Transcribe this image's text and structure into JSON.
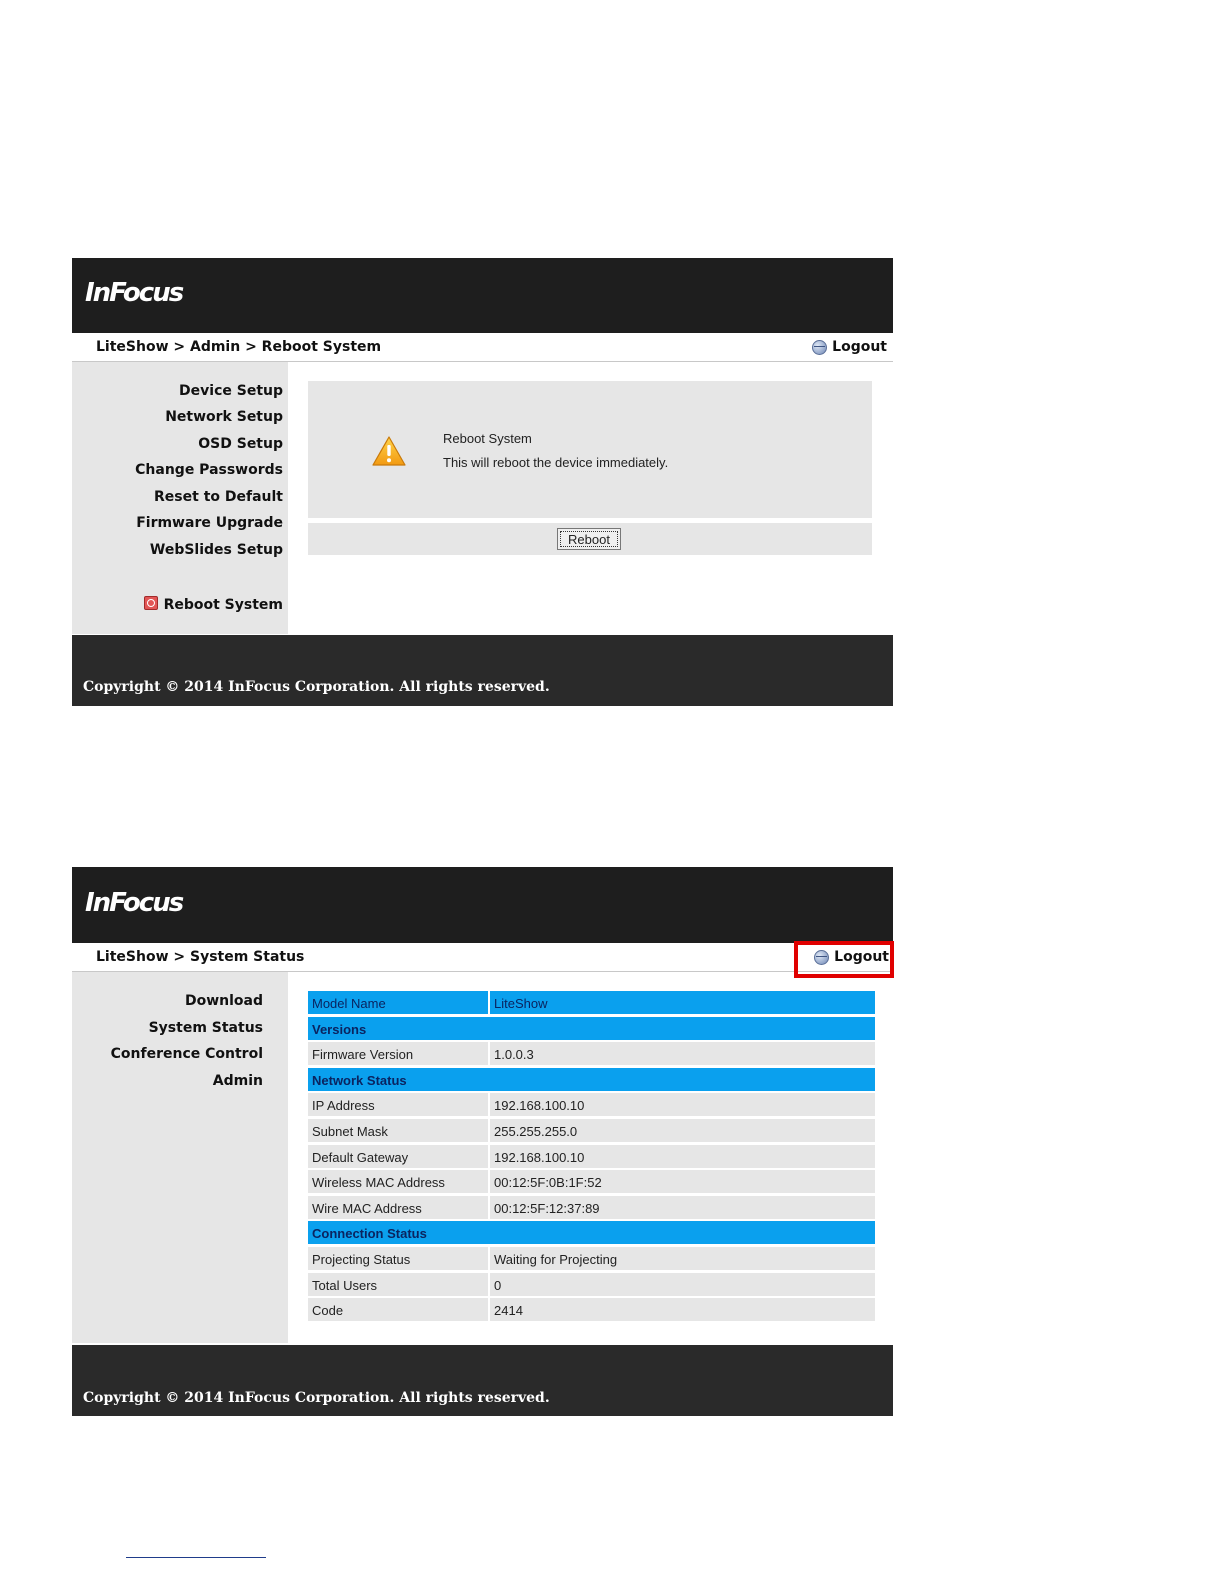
{
  "screen1": {
    "logo": "InFocus",
    "breadcrumb": "LiteShow > Admin > Reboot System",
    "logout_label": "Logout",
    "nav": [
      "Device Setup",
      "Network Setup",
      "OSD Setup",
      "Change Passwords",
      "Reset to Default",
      "Firmware Upgrade",
      "WebSlides Setup"
    ],
    "nav_active": "Reboot System",
    "reboot_title": "Reboot System",
    "reboot_desc": "This will reboot the device immediately.",
    "reboot_button": "Reboot",
    "copyright": "Copyright © 2014 InFocus Corporation. All rights reserved."
  },
  "screen2": {
    "logo": "InFocus",
    "breadcrumb": "LiteShow > System Status",
    "logout_label": "Logout",
    "nav": [
      "Download",
      "System Status",
      "Conference Control",
      "Admin"
    ],
    "status": {
      "model_label": "Model Name",
      "model_value": "LiteShow",
      "sections": [
        {
          "title": "Versions",
          "rows": [
            [
              "Firmware Version",
              "1.0.0.3"
            ]
          ]
        },
        {
          "title": "Network Status",
          "rows": [
            [
              "IP Address",
              "192.168.100.10"
            ],
            [
              "Subnet Mask",
              "255.255.255.0"
            ],
            [
              "Default Gateway",
              "192.168.100.10"
            ],
            [
              "Wireless MAC Address",
              "00:12:5F:0B:1F:52"
            ],
            [
              "Wire MAC Address",
              "00:12:5F:12:37:89"
            ]
          ]
        },
        {
          "title": "Connection Status",
          "rows": [
            [
              "Projecting Status",
              "Waiting for Projecting"
            ],
            [
              "Total Users",
              "0"
            ],
            [
              "Code",
              "2414"
            ]
          ]
        }
      ]
    },
    "copyright": "Copyright © 2014 InFocus Corporation. All rights reserved."
  },
  "colors": {
    "header": "#1e1e1e",
    "accent_blue": "#0aa0ee",
    "highlight": "#e00000",
    "sidebar": "#e6e6e6"
  }
}
